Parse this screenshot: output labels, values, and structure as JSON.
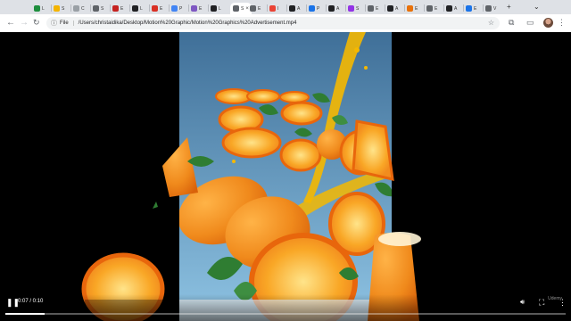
{
  "browser": {
    "tabs": [
      {
        "label": "L",
        "color": "#1e8e3e"
      },
      {
        "label": "S",
        "color": "#f4b400"
      },
      {
        "label": "C",
        "color": "#9aa0a6"
      },
      {
        "label": "S",
        "color": "#5f6368"
      },
      {
        "label": "E",
        "color": "#c5221f"
      },
      {
        "label": "L",
        "color": "#202124"
      },
      {
        "label": "E",
        "color": "#d93025"
      },
      {
        "label": "P",
        "color": "#4285f4"
      },
      {
        "label": "E",
        "color": "#7e57c2"
      },
      {
        "label": "L",
        "color": "#202124"
      },
      {
        "label": "S",
        "color": "#5f6368",
        "active": true
      },
      {
        "label": "E",
        "color": "#5f6368"
      },
      {
        "label": "I",
        "color": "#ea4335"
      },
      {
        "label": "A",
        "color": "#202124"
      },
      {
        "label": "P",
        "color": "#1a73e8"
      },
      {
        "label": "A",
        "color": "#202124"
      },
      {
        "label": "S",
        "color": "#9334e6"
      },
      {
        "label": "E",
        "color": "#5f6368"
      },
      {
        "label": "A",
        "color": "#202124"
      },
      {
        "label": "E",
        "color": "#e8710a"
      },
      {
        "label": "E",
        "color": "#5f6368"
      },
      {
        "label": "A",
        "color": "#202124"
      },
      {
        "label": "E",
        "color": "#1a73e8"
      },
      {
        "label": "V",
        "color": "#5f6368"
      }
    ],
    "omnibox": {
      "scheme_label": "File",
      "url": "/Users/christaidika/Desktop/Motion%20Graphic/Motion%20Graphics%20Advertisement.mp4"
    }
  },
  "video": {
    "time_display": "0:07 / 0:10",
    "progress_fraction": 0.07,
    "watermark": "Udemy",
    "colors": {
      "sky_top": "#3f6f98",
      "sky_bottom": "#8ec3e3",
      "orange": "#f28c1e",
      "rind": "#e8660c",
      "leaf": "#2f7d32",
      "juice": "#f5b800"
    }
  }
}
